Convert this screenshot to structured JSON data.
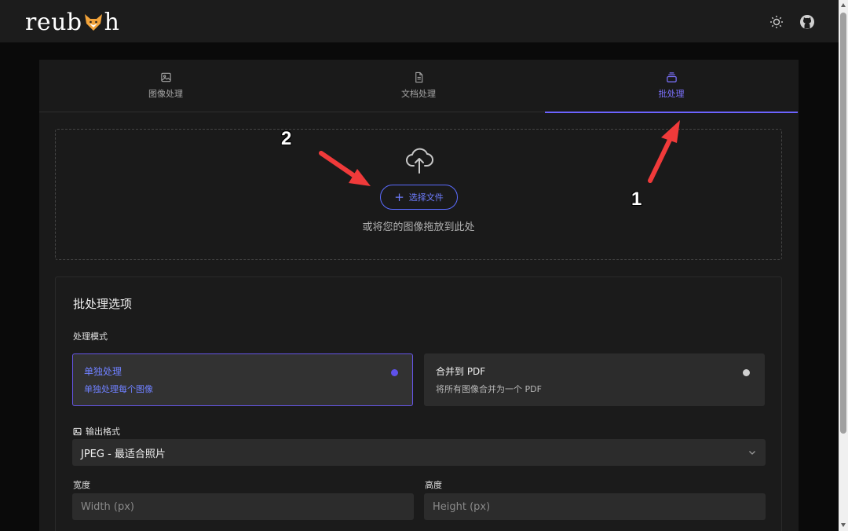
{
  "app": {
    "logo_text_left": "reub",
    "logo_text_right": "h",
    "logo_icon": "fox-icon"
  },
  "header": {
    "theme_icon": "sun-icon",
    "github_icon": "github-icon"
  },
  "tabs": [
    {
      "label": "图像处理",
      "icon": "image-icon",
      "active": false
    },
    {
      "label": "文档处理",
      "icon": "document-icon",
      "active": false
    },
    {
      "label": "批处理",
      "icon": "stack-icon",
      "active": true
    }
  ],
  "upload": {
    "button_label": "选择文件",
    "button_icon": "plus-icon",
    "hint": "或将您的图像拖放到此处",
    "icon": "cloud-upload-icon"
  },
  "options": {
    "title": "批处理选项",
    "mode_label": "处理模式",
    "modes": [
      {
        "title": "单独处理",
        "desc": "单独处理每个图像",
        "selected": true
      },
      {
        "title": "合并到 PDF",
        "desc": "将所有图像合并为一个 PDF",
        "selected": false
      }
    ],
    "format_label": "输出格式",
    "format_value": "JPEG - 最适合照片",
    "width_label": "宽度",
    "width_placeholder": "Width (px)",
    "height_label": "高度",
    "height_placeholder": "Height (px)"
  },
  "annotations": {
    "marker_1": "1",
    "marker_2": "2"
  },
  "colors": {
    "accent": "#6c63ff",
    "annotation_arrow": "#f03a3a",
    "background": "#0a0a0a"
  }
}
